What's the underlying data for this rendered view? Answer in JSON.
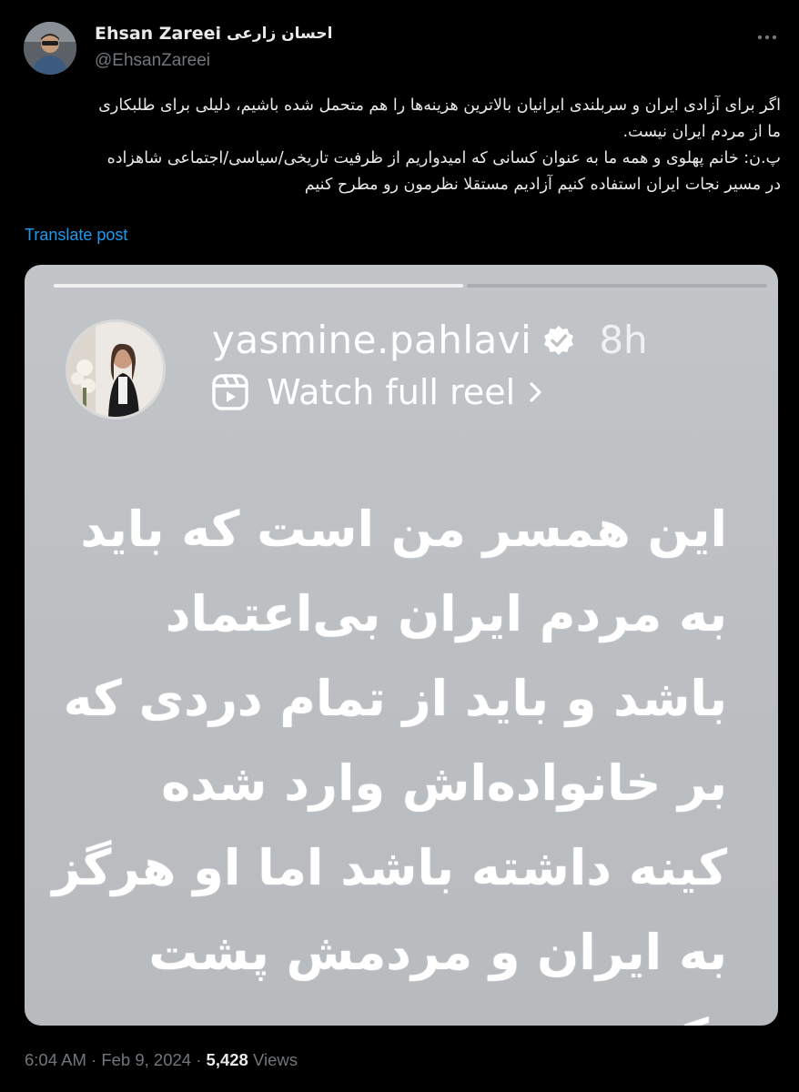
{
  "author": {
    "display_name": "Ehsan Zareei",
    "display_name_fa": "احسان زارعی",
    "handle": "@EhsanZareei"
  },
  "tweet": {
    "text_lines": [
      "اگر برای آزادی ایران و سربلندی ایرانیان بالاترین هزینه‌ها را هم متحمل شده باشیم، دلیلی برای طلبکاری",
      "ما از مردم ایران نیست.",
      "پ.ن: خانم پهلوی و همه ما به عنوان کسانی که امیدواریم از ظرفیت تاریخی/سیاسی/اجتماعی شاهزاده",
      "در مسیر نجات ایران استفاده کنیم آزادیم مستقلا نظرمون رو مطرح کنیم"
    ],
    "translate_label": "Translate post"
  },
  "story": {
    "username": "yasmine.pahlavi",
    "time": "8h",
    "reel_label": "Watch full reel",
    "text_lines": [
      "این همسر من است که باید",
      "به مردم ایران بی‌اعتماد",
      "باشد و باید از تمام دردی که",
      "بر خانواده‌اش وارد شده",
      "کینه داشته باشد اما  او هرگز",
      "به ایران و مردمش پشت",
      "نکرد."
    ]
  },
  "meta": {
    "time": "6:04 AM",
    "separator": "·",
    "date": "Feb 9, 2024",
    "views_count": "5,428",
    "views_label": "Views"
  },
  "icons": {
    "more": "more-horizontal-icon",
    "verified": "verified-badge-icon",
    "reel": "reel-icon",
    "chevron": "chevron-right-icon"
  },
  "colors": {
    "background": "#000000",
    "text": "#e7e9ea",
    "secondary_text": "#71767b",
    "link": "#1d9bf0",
    "story_background": "#bfc2c5"
  }
}
